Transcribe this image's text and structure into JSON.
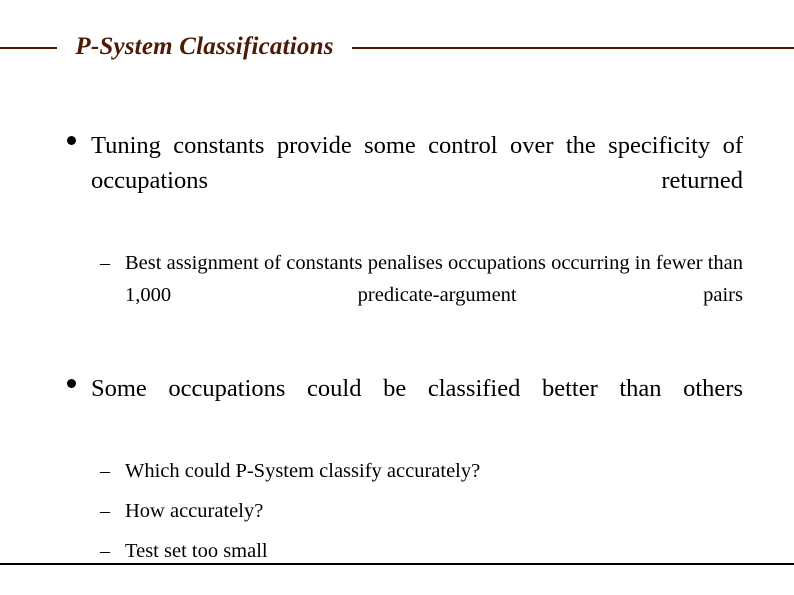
{
  "slide": {
    "title": "P-System Classifications",
    "title_color": "#4d1a06",
    "header_rule_color": "#4d1a06",
    "footer_rule_color": "#000000",
    "background_color": "#ffffff",
    "text_color": "#000000",
    "bullet_marker": "•",
    "sub_bullet_marker": "–",
    "bullets": [
      {
        "text": "Tuning constants provide some control over the specificity of occupations returned",
        "sub": [
          "Best assignment of constants penalises occupations occurring in fewer than 1,000 predicate-argument pairs"
        ]
      },
      {
        "text": "Some occupations could be classified better than others",
        "sub": [
          "Which could P-System classify accurately?",
          "How accurately?",
          "Test set too small"
        ]
      }
    ]
  }
}
